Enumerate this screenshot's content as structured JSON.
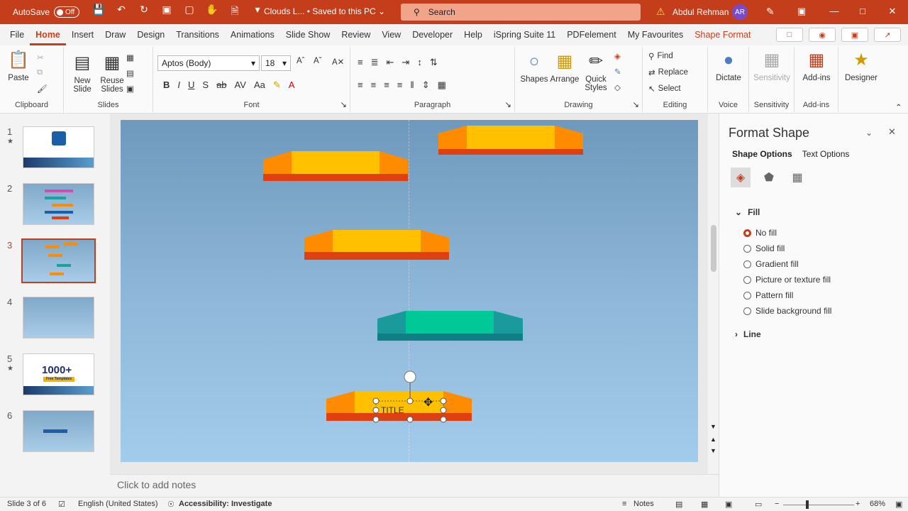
{
  "titlebar": {
    "autosave_label": "AutoSave",
    "autosave_state": "Off",
    "doc_title": "Clouds L... • Saved to this PC ⌄",
    "search_placeholder": "Search",
    "user_name": "Abdul Rehman",
    "user_initials": "AR"
  },
  "tabs": [
    "File",
    "Home",
    "Insert",
    "Draw",
    "Design",
    "Transitions",
    "Animations",
    "Slide Show",
    "Review",
    "View",
    "Developer",
    "Help",
    "iSpring Suite 11",
    "PDFelement",
    "My Favourites",
    "Shape Format"
  ],
  "ribbon": {
    "clipboard": {
      "paste": "Paste",
      "label": "Clipboard"
    },
    "slides": {
      "new_slide": "New Slide",
      "reuse_slides": "Reuse Slides",
      "label": "Slides"
    },
    "font": {
      "family": "Aptos (Body)",
      "size": "18",
      "label": "Font"
    },
    "paragraph": {
      "label": "Paragraph"
    },
    "drawing": {
      "shapes": "Shapes",
      "arrange": "Arrange",
      "quick_styles": "Quick Styles",
      "label": "Drawing"
    },
    "editing": {
      "find": "Find",
      "replace": "Replace",
      "select": "Select",
      "label": "Editing"
    },
    "voice": {
      "dictate": "Dictate",
      "label": "Voice"
    },
    "sensitivity": {
      "button": "Sensitivity",
      "label": "Sensitivity"
    },
    "addins": {
      "button": "Add-ins",
      "label": "Add-ins"
    },
    "designer": {
      "button": "Designer"
    }
  },
  "thumbnails": [
    {
      "num": "1",
      "star": true
    },
    {
      "num": "2",
      "star": false
    },
    {
      "num": "3",
      "star": false,
      "selected": true
    },
    {
      "num": "4",
      "star": false
    },
    {
      "num": "5",
      "star": true,
      "text": "1000+",
      "subtext": "Free Templates"
    },
    {
      "num": "6",
      "star": false
    }
  ],
  "slide": {
    "selected_text": "TITLE"
  },
  "notes_placeholder": "Click to add notes",
  "pane": {
    "title": "Format Shape",
    "tab_shape": "Shape Options",
    "tab_text": "Text Options",
    "fill_header": "Fill",
    "fill_options": [
      "No fill",
      "Solid fill",
      "Gradient fill",
      "Picture or texture fill",
      "Pattern fill",
      "Slide background fill"
    ],
    "fill_selected": "No fill",
    "line_header": "Line"
  },
  "status": {
    "slide_info": "Slide 3 of 6",
    "language": "English (United States)",
    "accessibility": "Accessibility: Investigate",
    "notes": "Notes",
    "zoom": "68%"
  },
  "colors": {
    "accent": "#c43e1c",
    "orange_side": "#ff8c00",
    "yellow_top": "#ffc000",
    "red_bottom": "#e04010",
    "teal_side": "#1a9a9a",
    "teal_top": "#00c896"
  }
}
